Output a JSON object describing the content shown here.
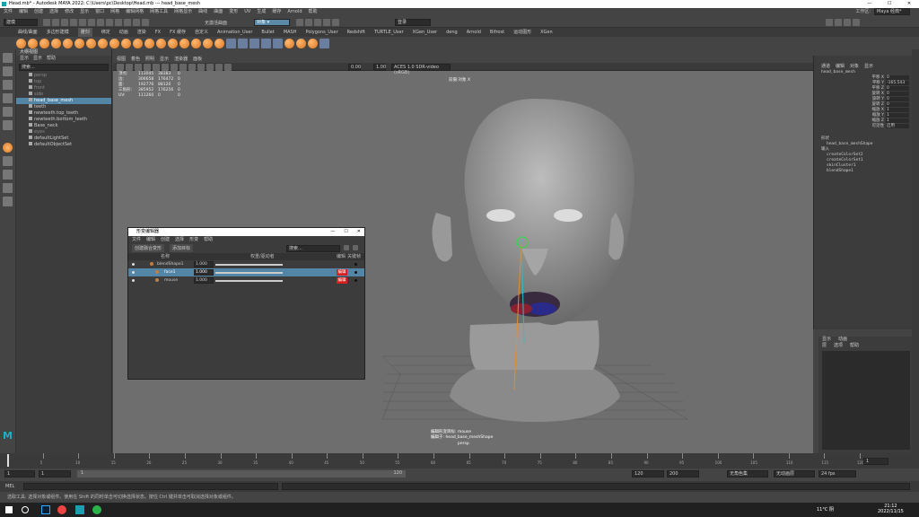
{
  "window": {
    "title": "Head.mb* - Autodesk MAYA 2022: C:\\Users\\pc\\Desktop\\Head.mb --- head_base_mesh",
    "min": "—",
    "max": "☐",
    "close": "✕"
  },
  "menubar": {
    "items": [
      "文件",
      "编辑",
      "创建",
      "选择",
      "修改",
      "显示",
      "窗口",
      "网格",
      "编辑网格",
      "网格工具",
      "网格显示",
      "曲线",
      "曲面",
      "变形",
      "UV",
      "生成",
      "缓存",
      "Arnold",
      "帮助"
    ],
    "workspace_label": "工作区:",
    "workspace": "Maya 经典*"
  },
  "statusline": {
    "mode": "建模",
    "no_live": "无激活曲面",
    "object": "对象 ▾",
    "symmetry": "对称:关闭",
    "sign_in": "登录"
  },
  "shelf": {
    "tabs": [
      "曲线/曲面",
      "多边形建模",
      "雕刻",
      "绑定",
      "动画",
      "渲染",
      "FX",
      "FX 缓存",
      "自定义",
      "Animation_User",
      "Bullet",
      "MASH",
      "Polygons_User",
      "Redshift",
      "TURTLE_User",
      "XGen_User",
      "deng",
      "Arnold",
      "Bifrost",
      "运动图形",
      "XGen"
    ],
    "active": "雕刻"
  },
  "outliner": {
    "title": "大纲视图",
    "menu": [
      "显示",
      "显示",
      "帮助"
    ],
    "search": "搜索...",
    "items": [
      {
        "label": "persp",
        "dim": true
      },
      {
        "label": "top",
        "dim": true
      },
      {
        "label": "front",
        "dim": true
      },
      {
        "label": "side",
        "dim": true
      },
      {
        "label": "head_base_mesh",
        "sel": true
      },
      {
        "label": "teeth"
      },
      {
        "label": "newteeth:top_teeth"
      },
      {
        "label": "newteeth:bottom_teeth"
      },
      {
        "label": "Base_neck"
      },
      {
        "label": "eyes",
        "dim": true
      },
      {
        "label": "defaultLightSet"
      },
      {
        "label": "defaultObjectSet"
      }
    ]
  },
  "viewport": {
    "menu": [
      "视图",
      "着色",
      "照明",
      "显示",
      "渲染器",
      "面板"
    ],
    "exposure": "0.00",
    "gamma": "1.00",
    "colorspace": "ACES 1.0 SDR-video (sRGB)",
    "cam_label": "前摄:对象 X",
    "stats": [
      [
        "顶点:",
        "113045",
        "38383",
        "0"
      ],
      [
        "边:",
        "306658",
        "176472",
        "0"
      ],
      [
        "面:",
        "192776",
        "88120",
        "0"
      ],
      [
        "三角形:",
        "385952",
        "176256",
        "0"
      ],
      [
        "UV:",
        "111260",
        "0",
        "0"
      ]
    ],
    "hud_line1": "编辑形变目标: mouse",
    "hud_line2": "编辑于: head_base_meshShape",
    "persp": "persp"
  },
  "shape_editor": {
    "title": "形变编辑器",
    "menu": [
      "文件",
      "编辑",
      "创建",
      "选择",
      "形变",
      "帮助"
    ],
    "btn_create": "创建融合变形",
    "btn_add": "添加目标",
    "search": "搜索...",
    "col_name": "名称",
    "col_weight": "权重/驱动者",
    "col_edit": "编辑",
    "col_key": "关键帧",
    "rows": [
      {
        "name": "blendShape1",
        "weight": "1.000",
        "fill": 1.0
      },
      {
        "name": "face1",
        "weight": "1.000",
        "fill": 1.0,
        "edit": "编辑",
        "sel": true
      },
      {
        "name": "mouse",
        "weight": "1.000",
        "fill": 1.0,
        "edit": "编辑"
      }
    ]
  },
  "attr": {
    "tabs": [
      "通道",
      "编辑",
      "对象",
      "显示"
    ],
    "object": "head_base_mesh",
    "channels": [
      [
        "平移 X",
        "0"
      ],
      [
        "平移 Y",
        "-165.543"
      ],
      [
        "平移 Z",
        "0"
      ],
      [
        "旋转 X",
        "0"
      ],
      [
        "旋转 Y",
        "0"
      ],
      [
        "旋转 Z",
        "0"
      ],
      [
        "缩放 X",
        "1"
      ],
      [
        "缩放 Y",
        "1"
      ],
      [
        "缩放 Z",
        "1"
      ],
      [
        "可见性",
        "启用"
      ]
    ],
    "shapes_label": "形状",
    "shape": "head_base_meshShape",
    "inputs_label": "输入",
    "inputs": [
      "createColorSet2",
      "createColorSet1",
      "skinCluster1",
      "blendShape1"
    ]
  },
  "layers": {
    "tabs": [
      "显示",
      "动画"
    ],
    "menu": [
      "层",
      "选项",
      "帮助"
    ]
  },
  "timeline": {
    "ticks": [
      "5",
      "10",
      "15",
      "20",
      "25",
      "30",
      "35",
      "40",
      "45",
      "50",
      "55",
      "60",
      "65",
      "70",
      "75",
      "80",
      "85",
      "90",
      "95",
      "100",
      "105",
      "110",
      "115",
      "120"
    ],
    "current": "1"
  },
  "range": {
    "start": "1",
    "start2": "1",
    "cur": "1",
    "end_mid": "120",
    "end": "120",
    "max": "200",
    "char_set": "无角色集",
    "anim_layer": "无动画层",
    "fps": "24 fps"
  },
  "mel": {
    "label": "MEL"
  },
  "help": "选取工具: 选择对象或组件。使用在 Shift 的同时单击可切换选择状态。按住 Ctrl 键并单击可取消选择对象或组件。",
  "taskbar": {
    "weather": "11°C 阴",
    "time": "21:12",
    "date": "2022/11/15"
  }
}
